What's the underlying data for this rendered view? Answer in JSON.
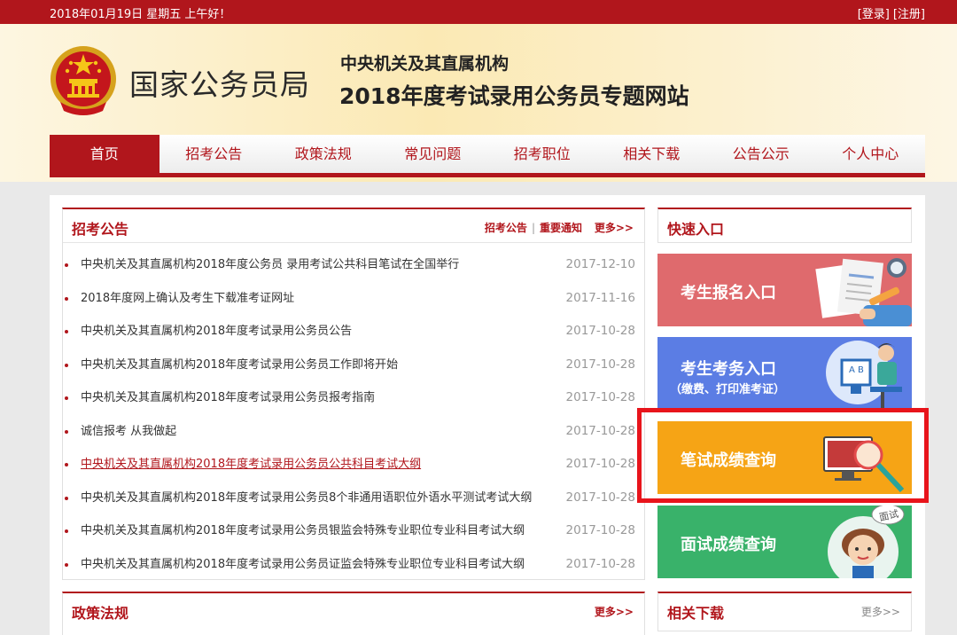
{
  "topbar": {
    "date": "2018年01月19日  星期五  上午好！",
    "login": "[登录]",
    "register": "[注册]"
  },
  "header": {
    "brand": "国家公务员局",
    "subtitle": "中央机关及其直属机构",
    "title": "2018年度考试录用公务员专题网站"
  },
  "nav": {
    "items": [
      "首页",
      "招考公告",
      "政策法规",
      "常见问题",
      "招考职位",
      "相关下载",
      "公告公示",
      "个人中心"
    ],
    "active": "首页"
  },
  "announcements": {
    "title": "招考公告",
    "tab1": "招考公告",
    "tab_sep": "|",
    "tab2": "重要通知",
    "more": "更多>>",
    "items": [
      {
        "text": "中央机关及其直属机构2018年度公务员 录用考试公共科目笔试在全国举行",
        "date": "2017-12-10"
      },
      {
        "text": "2018年度网上确认及考生下载准考证网址",
        "date": "2017-11-16"
      },
      {
        "text": "中央机关及其直属机构2018年度考试录用公务员公告",
        "date": "2017-10-28"
      },
      {
        "text": "中央机关及其直属机构2018年度考试录用公务员工作即将开始",
        "date": "2017-10-28"
      },
      {
        "text": "中央机关及其直属机构2018年度考试录用公务员报考指南",
        "date": "2017-10-28"
      },
      {
        "text": "诚信报考   从我做起",
        "date": "2017-10-28"
      },
      {
        "text": "中央机关及其直属机构2018年度考试录用公务员公共科目考试大纲",
        "date": "2017-10-28"
      },
      {
        "text": "中央机关及其直属机构2018年度考试录用公务员8个非通用语职位外语水平测试考试大纲",
        "date": "2017-10-28"
      },
      {
        "text": "中央机关及其直属机构2018年度考试录用公务员银监会特殊专业职位专业科目考试大纲",
        "date": "2017-10-28"
      },
      {
        "text": "中央机关及其直属机构2018年度考试录用公务员证监会特殊专业职位专业科目考试大纲",
        "date": "2017-10-28"
      }
    ]
  },
  "policy": {
    "title": "政策法规",
    "more": "更多>>"
  },
  "quick": {
    "title": "快速入口",
    "registration": "考生报名入口",
    "affairs": "考生考务入口",
    "affairs_sub": "（缴费、打印准考证）",
    "written_score": "笔试成绩查询",
    "interview_score": "面试成绩查询",
    "interview_bubble": "面试"
  },
  "downloads": {
    "title": "相关下载",
    "more": "更多>>"
  },
  "colors": {
    "brand_red": "#b1161c",
    "registration_bg": "#df6a6d",
    "affairs_bg": "#5b7de4",
    "written_bg": "#f6a415",
    "interview_bg": "#39b26a",
    "highlight": "#e8141b"
  }
}
